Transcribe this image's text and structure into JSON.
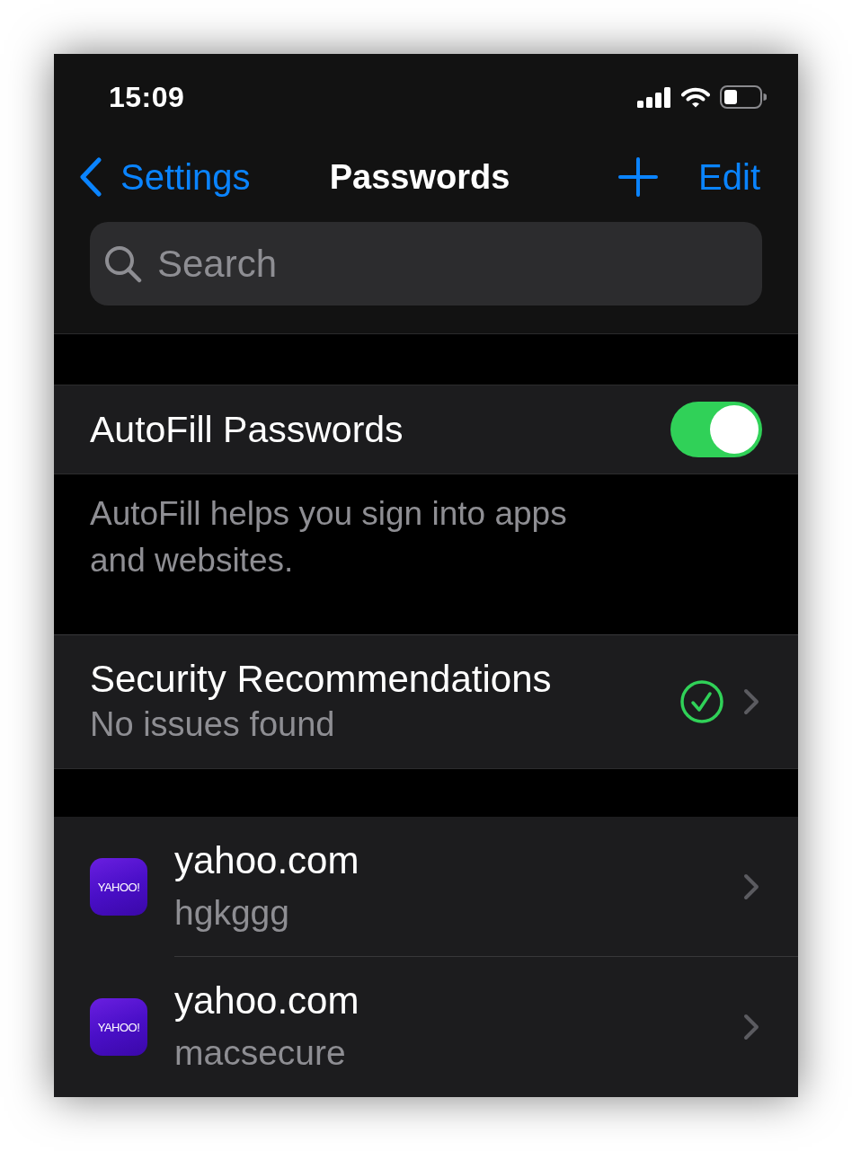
{
  "status_bar": {
    "time": "15:09"
  },
  "nav_bar": {
    "back_label": "Settings",
    "title": "Passwords",
    "edit_label": "Edit"
  },
  "search": {
    "placeholder": "Search"
  },
  "autofill": {
    "label": "AutoFill Passwords",
    "on": true,
    "footer": "AutoFill helps you sign into apps and websites."
  },
  "security": {
    "title": "Security Recommendations",
    "subtitle": "No issues found"
  },
  "passwords": [
    {
      "logo_text": "YAHOO!",
      "site": "yahoo.com",
      "username": "hgkggg"
    },
    {
      "logo_text": "YAHOO!",
      "site": "yahoo.com",
      "username": "macsecure"
    }
  ]
}
